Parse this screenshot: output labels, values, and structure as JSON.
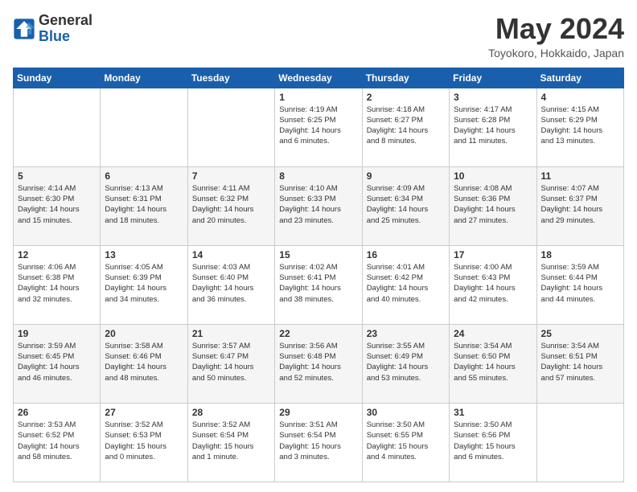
{
  "logo": {
    "line1": "General",
    "line2": "Blue"
  },
  "title": "May 2024",
  "location": "Toyokoro, Hokkaido, Japan",
  "weekdays": [
    "Sunday",
    "Monday",
    "Tuesday",
    "Wednesday",
    "Thursday",
    "Friday",
    "Saturday"
  ],
  "weeks": [
    [
      {
        "day": "",
        "info": ""
      },
      {
        "day": "",
        "info": ""
      },
      {
        "day": "",
        "info": ""
      },
      {
        "day": "1",
        "info": "Sunrise: 4:19 AM\nSunset: 6:25 PM\nDaylight: 14 hours\nand 6 minutes."
      },
      {
        "day": "2",
        "info": "Sunrise: 4:18 AM\nSunset: 6:27 PM\nDaylight: 14 hours\nand 8 minutes."
      },
      {
        "day": "3",
        "info": "Sunrise: 4:17 AM\nSunset: 6:28 PM\nDaylight: 14 hours\nand 11 minutes."
      },
      {
        "day": "4",
        "info": "Sunrise: 4:15 AM\nSunset: 6:29 PM\nDaylight: 14 hours\nand 13 minutes."
      }
    ],
    [
      {
        "day": "5",
        "info": "Sunrise: 4:14 AM\nSunset: 6:30 PM\nDaylight: 14 hours\nand 15 minutes."
      },
      {
        "day": "6",
        "info": "Sunrise: 4:13 AM\nSunset: 6:31 PM\nDaylight: 14 hours\nand 18 minutes."
      },
      {
        "day": "7",
        "info": "Sunrise: 4:11 AM\nSunset: 6:32 PM\nDaylight: 14 hours\nand 20 minutes."
      },
      {
        "day": "8",
        "info": "Sunrise: 4:10 AM\nSunset: 6:33 PM\nDaylight: 14 hours\nand 23 minutes."
      },
      {
        "day": "9",
        "info": "Sunrise: 4:09 AM\nSunset: 6:34 PM\nDaylight: 14 hours\nand 25 minutes."
      },
      {
        "day": "10",
        "info": "Sunrise: 4:08 AM\nSunset: 6:36 PM\nDaylight: 14 hours\nand 27 minutes."
      },
      {
        "day": "11",
        "info": "Sunrise: 4:07 AM\nSunset: 6:37 PM\nDaylight: 14 hours\nand 29 minutes."
      }
    ],
    [
      {
        "day": "12",
        "info": "Sunrise: 4:06 AM\nSunset: 6:38 PM\nDaylight: 14 hours\nand 32 minutes."
      },
      {
        "day": "13",
        "info": "Sunrise: 4:05 AM\nSunset: 6:39 PM\nDaylight: 14 hours\nand 34 minutes."
      },
      {
        "day": "14",
        "info": "Sunrise: 4:03 AM\nSunset: 6:40 PM\nDaylight: 14 hours\nand 36 minutes."
      },
      {
        "day": "15",
        "info": "Sunrise: 4:02 AM\nSunset: 6:41 PM\nDaylight: 14 hours\nand 38 minutes."
      },
      {
        "day": "16",
        "info": "Sunrise: 4:01 AM\nSunset: 6:42 PM\nDaylight: 14 hours\nand 40 minutes."
      },
      {
        "day": "17",
        "info": "Sunrise: 4:00 AM\nSunset: 6:43 PM\nDaylight: 14 hours\nand 42 minutes."
      },
      {
        "day": "18",
        "info": "Sunrise: 3:59 AM\nSunset: 6:44 PM\nDaylight: 14 hours\nand 44 minutes."
      }
    ],
    [
      {
        "day": "19",
        "info": "Sunrise: 3:59 AM\nSunset: 6:45 PM\nDaylight: 14 hours\nand 46 minutes."
      },
      {
        "day": "20",
        "info": "Sunrise: 3:58 AM\nSunset: 6:46 PM\nDaylight: 14 hours\nand 48 minutes."
      },
      {
        "day": "21",
        "info": "Sunrise: 3:57 AM\nSunset: 6:47 PM\nDaylight: 14 hours\nand 50 minutes."
      },
      {
        "day": "22",
        "info": "Sunrise: 3:56 AM\nSunset: 6:48 PM\nDaylight: 14 hours\nand 52 minutes."
      },
      {
        "day": "23",
        "info": "Sunrise: 3:55 AM\nSunset: 6:49 PM\nDaylight: 14 hours\nand 53 minutes."
      },
      {
        "day": "24",
        "info": "Sunrise: 3:54 AM\nSunset: 6:50 PM\nDaylight: 14 hours\nand 55 minutes."
      },
      {
        "day": "25",
        "info": "Sunrise: 3:54 AM\nSunset: 6:51 PM\nDaylight: 14 hours\nand 57 minutes."
      }
    ],
    [
      {
        "day": "26",
        "info": "Sunrise: 3:53 AM\nSunset: 6:52 PM\nDaylight: 14 hours\nand 58 minutes."
      },
      {
        "day": "27",
        "info": "Sunrise: 3:52 AM\nSunset: 6:53 PM\nDaylight: 15 hours\nand 0 minutes."
      },
      {
        "day": "28",
        "info": "Sunrise: 3:52 AM\nSunset: 6:54 PM\nDaylight: 15 hours\nand 1 minute."
      },
      {
        "day": "29",
        "info": "Sunrise: 3:51 AM\nSunset: 6:54 PM\nDaylight: 15 hours\nand 3 minutes."
      },
      {
        "day": "30",
        "info": "Sunrise: 3:50 AM\nSunset: 6:55 PM\nDaylight: 15 hours\nand 4 minutes."
      },
      {
        "day": "31",
        "info": "Sunrise: 3:50 AM\nSunset: 6:56 PM\nDaylight: 15 hours\nand 6 minutes."
      },
      {
        "day": "",
        "info": ""
      }
    ]
  ]
}
